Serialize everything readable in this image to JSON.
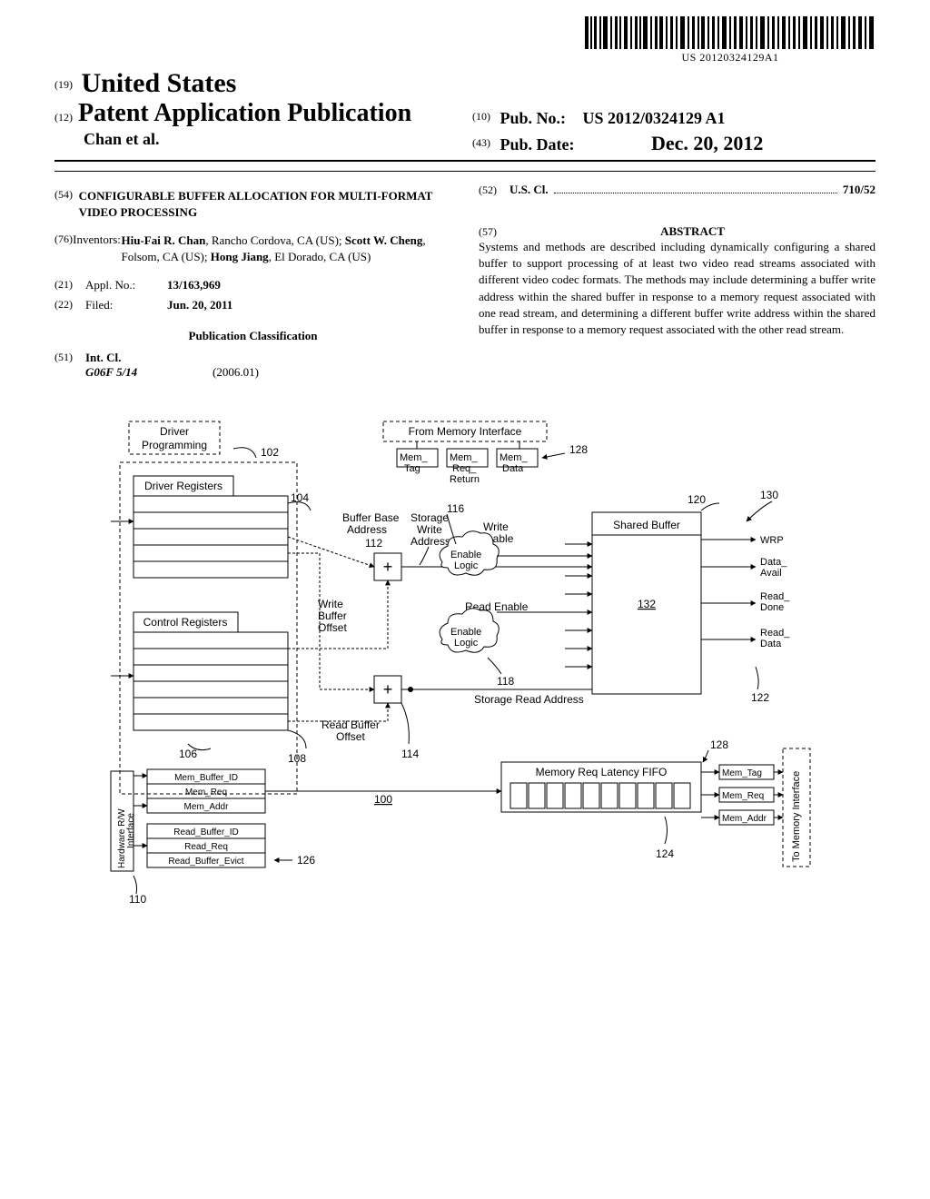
{
  "barcode_text": "US 20120324129A1",
  "header": {
    "num19": "(19)",
    "country": "United States",
    "num12": "(12)",
    "pub_app": "Patent Application Publication",
    "authors_line": "Chan et al.",
    "num10": "(10)",
    "pub_no_label": "Pub. No.:",
    "pub_no": "US 2012/0324129 A1",
    "num43": "(43)",
    "pub_date_label": "Pub. Date:",
    "pub_date": "Dec. 20, 2012"
  },
  "left": {
    "f54_num": "(54)",
    "f54_title": "CONFIGURABLE BUFFER ALLOCATION FOR MULTI-FORMAT VIDEO PROCESSING",
    "f76_num": "(76)",
    "f76_label": "Inventors:",
    "f76_value": "<b>Hiu-Fai R. Chan</b>, Rancho Cordova, CA (US); <b>Scott W. Cheng</b>, Folsom, CA (US); <b>Hong Jiang</b>, El Dorado, CA (US)",
    "f21_num": "(21)",
    "f21_label": "Appl. No.:",
    "f21_value": "13/163,969",
    "f22_num": "(22)",
    "f22_label": "Filed:",
    "f22_value": "Jun. 20, 2011",
    "pub_class": "Publication Classification",
    "f51_num": "(51)",
    "f51_label": "Int. Cl.",
    "f51_code": "G06F 5/14",
    "f51_year": "(2006.01)"
  },
  "right": {
    "f52_num": "(52)",
    "f52_label": "U.S. Cl.",
    "f52_value": "710/52",
    "f57_num": "(57)",
    "abstract_title": "ABSTRACT",
    "abstract": "Systems and methods are described including dynamically configuring a shared buffer to support processing of at least two video read streams associated with different video codec formats. The methods may include determining a buffer write address within the shared buffer in response to a memory request associated with one read stream, and determining a different buffer write address within the shared buffer in response to a memory request associated with the other read stream."
  },
  "diagram": {
    "driver_programming": "Driver\nProgramming",
    "from_mem_iface": "From Memory Interface",
    "driver_registers": "Driver Registers",
    "control_registers": "Control Registers",
    "buffer_base_addr": "Buffer Base\nAddress",
    "write_buffer_offset": "Write\nBuffer\nOffset",
    "read_buffer_offset": "Read Buffer\nOffset",
    "mem_tag": "Mem_\nTag",
    "mem_req_return": "Mem_\nReq_\nReturn",
    "mem_data": "Mem_\nData",
    "storage_write_addr": "Storage\nWrite\nAddress",
    "write_enable": "Write\nEnable",
    "enable_logic": "Enable\nLogic",
    "read_enable": "Read Enable",
    "shared_buffer": "Shared Buffer",
    "storage_read_addr": "Storage Read Address",
    "mem_req_fifo": "Memory Req Latency FIFO",
    "hw_rw_iface": "Hardware R/W\nInterface",
    "to_mem_iface": "To Memory Interface",
    "mem_buffer_id": "Mem_Buffer_ID",
    "mem_req": "Mem_Req",
    "mem_addr": "Mem_Addr",
    "read_buffer_id": "Read_Buffer_ID",
    "read_req": "Read_Req",
    "read_buffer_evict": "Read_Buffer_Evict",
    "wrp": "WRP",
    "data_avail": "Data_\nAvail",
    "read_done": "Read_\nDone",
    "read_data": "Read_\nData",
    "right_mem_tag": "Mem_Tag",
    "right_mem_req": "Mem_Req",
    "right_mem_addr": "Mem_Addr",
    "n100": "100",
    "n102": "102",
    "n104": "104",
    "n106": "106",
    "n108": "108",
    "n110": "110",
    "n112": "112",
    "n114": "114",
    "n116": "116",
    "n118": "118",
    "n120": "120",
    "n122": "122",
    "n124": "124",
    "n126": "126",
    "n128a": "128",
    "n128b": "128",
    "n130": "130",
    "n132": "132"
  }
}
